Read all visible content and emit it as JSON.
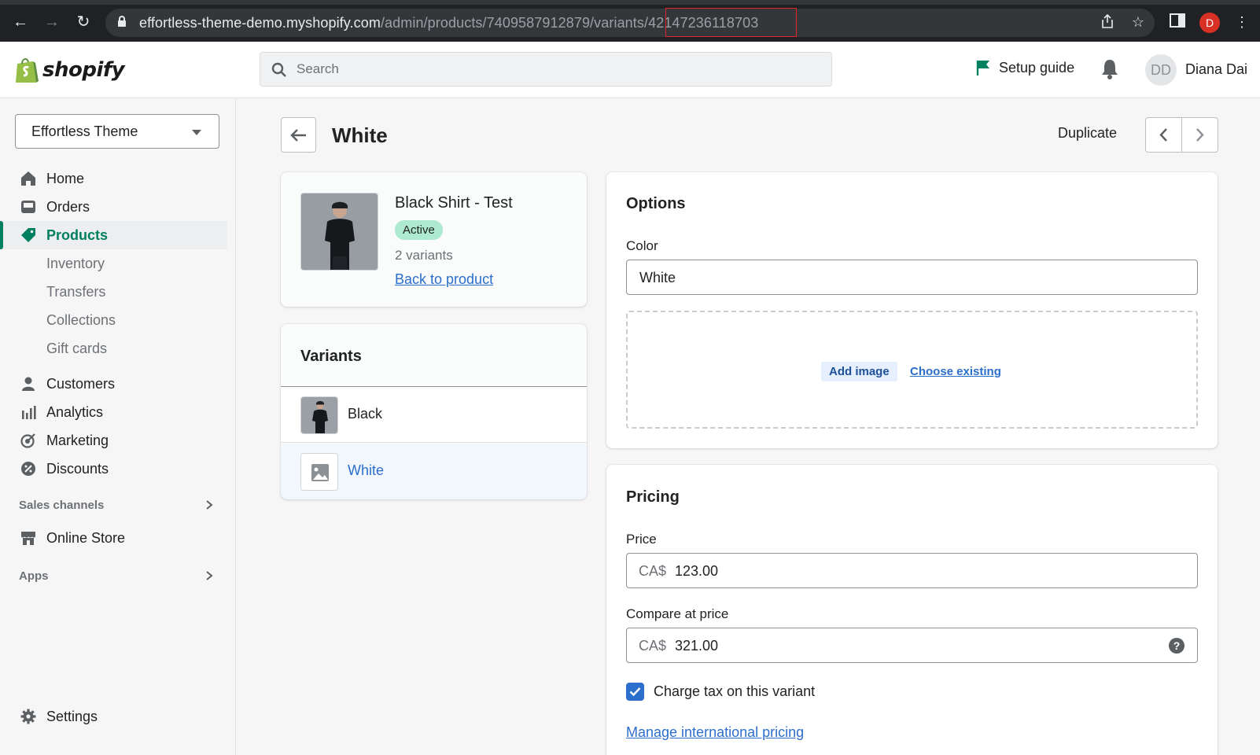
{
  "browser": {
    "url_host": "effortless-theme-demo.myshopify.com",
    "url_path_a": "/admin/products/7409587912879/variants",
    "url_path_b": "/42147236118703",
    "profile_initial": "D"
  },
  "topbar": {
    "logo_text": "shopify",
    "search_placeholder": "Search",
    "setup_guide": "Setup guide",
    "avatar_initials": "DD",
    "user_name": "Diana Dai"
  },
  "sidebar": {
    "store_name": "Effortless Theme",
    "items": {
      "home": "Home",
      "orders": "Orders",
      "products": "Products",
      "inventory": "Inventory",
      "transfers": "Transfers",
      "collections": "Collections",
      "gift_cards": "Gift cards",
      "customers": "Customers",
      "analytics": "Analytics",
      "marketing": "Marketing",
      "discounts": "Discounts",
      "sales_channels": "Sales channels",
      "online_store": "Online Store",
      "apps": "Apps",
      "settings": "Settings"
    }
  },
  "page": {
    "title": "White",
    "duplicate": "Duplicate"
  },
  "product": {
    "name": "Black Shirt - Test",
    "status": "Active",
    "variant_count": "2 variants",
    "back_link": "Back to product"
  },
  "variants": {
    "title": "Variants",
    "items": [
      "Black",
      "White"
    ]
  },
  "options": {
    "title": "Options",
    "color_label": "Color",
    "color_value": "White",
    "add_image": "Add image",
    "choose_existing": "Choose existing"
  },
  "pricing": {
    "title": "Pricing",
    "price_label": "Price",
    "currency": "CA$",
    "price_value": "123.00",
    "compare_label": "Compare at price",
    "compare_value": "321.00",
    "charge_tax_label": "Charge tax on this variant",
    "charge_tax_checked": true,
    "manage_link": "Manage international pricing"
  },
  "colors": {
    "brand_green": "#008060",
    "link_blue": "#2c6ecb",
    "badge_green": "#aee9d1"
  }
}
